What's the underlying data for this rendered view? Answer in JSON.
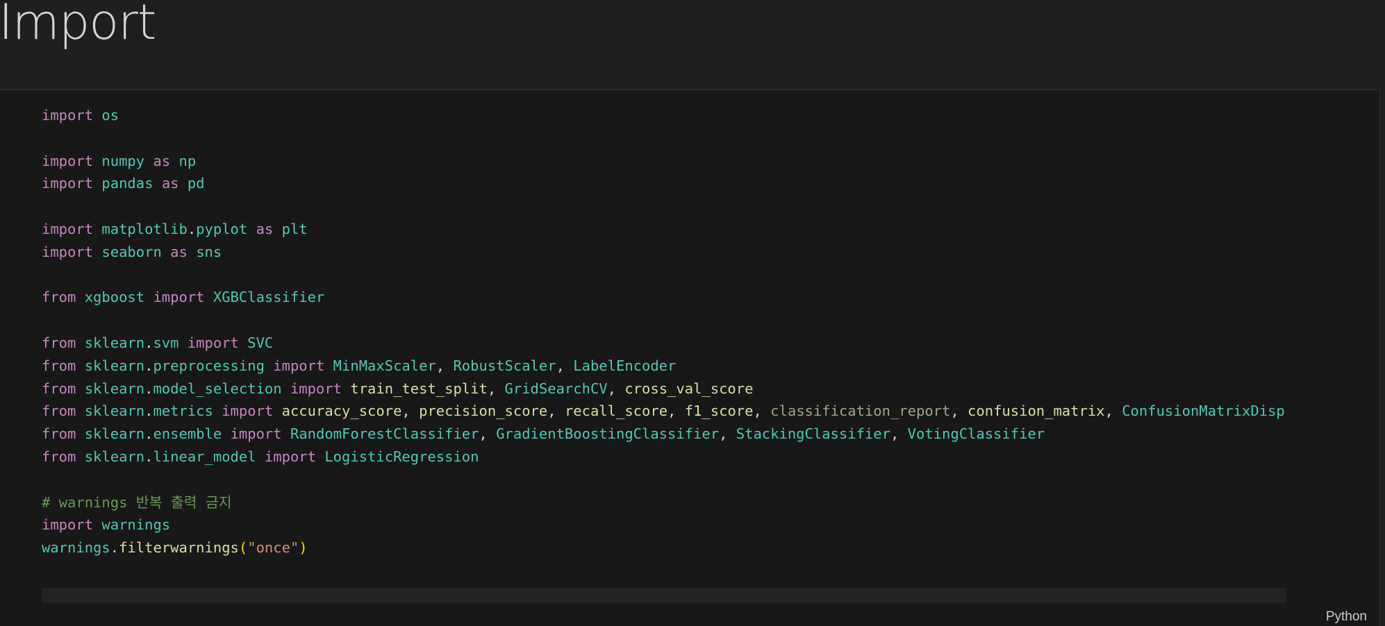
{
  "page": {
    "title": "Import"
  },
  "cell": {
    "language": "Python",
    "lines": [
      [
        {
          "t": "import",
          "c": "kw"
        },
        {
          "t": " ",
          "c": "plain"
        },
        {
          "t": "os",
          "c": "mod"
        }
      ],
      [],
      [
        {
          "t": "import",
          "c": "kw"
        },
        {
          "t": " ",
          "c": "plain"
        },
        {
          "t": "numpy",
          "c": "mod"
        },
        {
          "t": " ",
          "c": "plain"
        },
        {
          "t": "as",
          "c": "kw"
        },
        {
          "t": " ",
          "c": "plain"
        },
        {
          "t": "np",
          "c": "mod"
        }
      ],
      [
        {
          "t": "import",
          "c": "kw"
        },
        {
          "t": " ",
          "c": "plain"
        },
        {
          "t": "pandas",
          "c": "mod"
        },
        {
          "t": " ",
          "c": "plain"
        },
        {
          "t": "as",
          "c": "kw"
        },
        {
          "t": " ",
          "c": "plain"
        },
        {
          "t": "pd",
          "c": "mod"
        }
      ],
      [],
      [
        {
          "t": "import",
          "c": "kw"
        },
        {
          "t": " ",
          "c": "plain"
        },
        {
          "t": "matplotlib",
          "c": "mod"
        },
        {
          "t": ".",
          "c": "plain"
        },
        {
          "t": "pyplot",
          "c": "mod"
        },
        {
          "t": " ",
          "c": "plain"
        },
        {
          "t": "as",
          "c": "kw"
        },
        {
          "t": " ",
          "c": "plain"
        },
        {
          "t": "plt",
          "c": "mod"
        }
      ],
      [
        {
          "t": "import",
          "c": "kw"
        },
        {
          "t": " ",
          "c": "plain"
        },
        {
          "t": "seaborn",
          "c": "mod"
        },
        {
          "t": " ",
          "c": "plain"
        },
        {
          "t": "as",
          "c": "kw"
        },
        {
          "t": " ",
          "c": "plain"
        },
        {
          "t": "sns",
          "c": "mod"
        }
      ],
      [],
      [
        {
          "t": "from",
          "c": "kw"
        },
        {
          "t": " ",
          "c": "plain"
        },
        {
          "t": "xgboost",
          "c": "mod"
        },
        {
          "t": " ",
          "c": "plain"
        },
        {
          "t": "import",
          "c": "kw"
        },
        {
          "t": " ",
          "c": "plain"
        },
        {
          "t": "XGBClassifier",
          "c": "mod"
        }
      ],
      [],
      [
        {
          "t": "from",
          "c": "kw"
        },
        {
          "t": " ",
          "c": "plain"
        },
        {
          "t": "sklearn",
          "c": "mod"
        },
        {
          "t": ".",
          "c": "plain"
        },
        {
          "t": "svm",
          "c": "mod"
        },
        {
          "t": " ",
          "c": "plain"
        },
        {
          "t": "import",
          "c": "kw"
        },
        {
          "t": " ",
          "c": "plain"
        },
        {
          "t": "SVC",
          "c": "mod"
        }
      ],
      [
        {
          "t": "from",
          "c": "kw"
        },
        {
          "t": " ",
          "c": "plain"
        },
        {
          "t": "sklearn",
          "c": "mod"
        },
        {
          "t": ".",
          "c": "plain"
        },
        {
          "t": "preprocessing",
          "c": "mod"
        },
        {
          "t": " ",
          "c": "plain"
        },
        {
          "t": "import",
          "c": "kw"
        },
        {
          "t": " ",
          "c": "plain"
        },
        {
          "t": "MinMaxScaler",
          "c": "mod"
        },
        {
          "t": ", ",
          "c": "plain"
        },
        {
          "t": "RobustScaler",
          "c": "mod"
        },
        {
          "t": ", ",
          "c": "plain"
        },
        {
          "t": "LabelEncoder",
          "c": "mod"
        }
      ],
      [
        {
          "t": "from",
          "c": "kw"
        },
        {
          "t": " ",
          "c": "plain"
        },
        {
          "t": "sklearn",
          "c": "mod"
        },
        {
          "t": ".",
          "c": "plain"
        },
        {
          "t": "model_selection",
          "c": "mod"
        },
        {
          "t": " ",
          "c": "plain"
        },
        {
          "t": "import",
          "c": "kw"
        },
        {
          "t": " ",
          "c": "plain"
        },
        {
          "t": "train_test_split",
          "c": "fn"
        },
        {
          "t": ", ",
          "c": "plain"
        },
        {
          "t": "GridSearchCV",
          "c": "mod"
        },
        {
          "t": ", ",
          "c": "plain"
        },
        {
          "t": "cross_val_score",
          "c": "fn"
        }
      ],
      [
        {
          "t": "from",
          "c": "kw"
        },
        {
          "t": " ",
          "c": "plain"
        },
        {
          "t": "sklearn",
          "c": "mod"
        },
        {
          "t": ".",
          "c": "plain"
        },
        {
          "t": "metrics",
          "c": "mod"
        },
        {
          "t": " ",
          "c": "plain"
        },
        {
          "t": "import",
          "c": "kw"
        },
        {
          "t": " ",
          "c": "plain"
        },
        {
          "t": "accuracy_score",
          "c": "fn"
        },
        {
          "t": ", ",
          "c": "plain"
        },
        {
          "t": "precision_score",
          "c": "fn"
        },
        {
          "t": ", ",
          "c": "plain"
        },
        {
          "t": "recall_score",
          "c": "fn"
        },
        {
          "t": ", ",
          "c": "plain"
        },
        {
          "t": "f1_score",
          "c": "fn"
        },
        {
          "t": ", ",
          "c": "plain"
        },
        {
          "t": "classification_report",
          "c": "dim"
        },
        {
          "t": ", ",
          "c": "plain"
        },
        {
          "t": "confusion_matrix",
          "c": "fn"
        },
        {
          "t": ", ",
          "c": "plain"
        },
        {
          "t": "ConfusionMatrixDisp",
          "c": "mod"
        }
      ],
      [
        {
          "t": "from",
          "c": "kw"
        },
        {
          "t": " ",
          "c": "plain"
        },
        {
          "t": "sklearn",
          "c": "mod"
        },
        {
          "t": ".",
          "c": "plain"
        },
        {
          "t": "ensemble",
          "c": "mod"
        },
        {
          "t": " ",
          "c": "plain"
        },
        {
          "t": "import",
          "c": "kw"
        },
        {
          "t": " ",
          "c": "plain"
        },
        {
          "t": "RandomForestClassifier",
          "c": "mod"
        },
        {
          "t": ", ",
          "c": "plain"
        },
        {
          "t": "GradientBoostingClassifier",
          "c": "mod"
        },
        {
          "t": ", ",
          "c": "plain"
        },
        {
          "t": "StackingClassifier",
          "c": "mod"
        },
        {
          "t": ", ",
          "c": "plain"
        },
        {
          "t": "VotingClassifier",
          "c": "mod"
        }
      ],
      [
        {
          "t": "from",
          "c": "kw"
        },
        {
          "t": " ",
          "c": "plain"
        },
        {
          "t": "sklearn",
          "c": "mod"
        },
        {
          "t": ".",
          "c": "plain"
        },
        {
          "t": "linear_model",
          "c": "mod"
        },
        {
          "t": " ",
          "c": "plain"
        },
        {
          "t": "import",
          "c": "kw"
        },
        {
          "t": " ",
          "c": "plain"
        },
        {
          "t": "LogisticRegression",
          "c": "mod"
        }
      ],
      [],
      [
        {
          "t": "# warnings 반복 출력 금지",
          "c": "cmt"
        }
      ],
      [
        {
          "t": "import",
          "c": "kw"
        },
        {
          "t": " ",
          "c": "plain"
        },
        {
          "t": "warnings",
          "c": "mod"
        }
      ],
      [
        {
          "t": "warnings",
          "c": "mod"
        },
        {
          "t": ".",
          "c": "plain"
        },
        {
          "t": "filterwarnings",
          "c": "fn"
        },
        {
          "t": "(",
          "c": "paren"
        },
        {
          "t": "\"once\"",
          "c": "str"
        },
        {
          "t": ")",
          "c": "paren"
        }
      ]
    ]
  },
  "colors": {
    "background": "#1f1f1f",
    "cell_background": "#181818",
    "keyword": "#c586c0",
    "module": "#4ec9b0",
    "function": "#dcdcaa",
    "string": "#ce9178",
    "comment": "#6a9955"
  }
}
